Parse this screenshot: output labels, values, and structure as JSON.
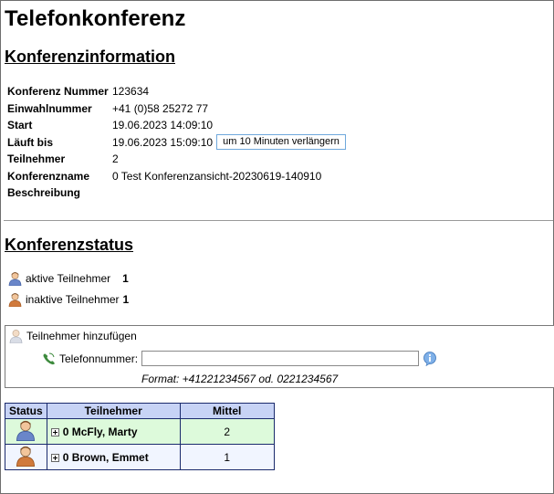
{
  "page": {
    "title": "Telefonkonferenz"
  },
  "conference_info": {
    "heading": "Konferenzinformation",
    "rows": [
      {
        "label": "Konferenz Nummer",
        "value": "123634"
      },
      {
        "label": "Einwahlnummer",
        "value": "+41 (0)58 25272 77"
      },
      {
        "label": "Start",
        "value": "19.06.2023 14:09:10"
      },
      {
        "label": "Läuft bis",
        "value": "19.06.2023 15:09:10"
      },
      {
        "label": "Teilnehmer",
        "value": "2"
      },
      {
        "label": "Konferenzname",
        "value": "0 Test Konferenzansicht-20230619-140910"
      },
      {
        "label": "Beschreibung",
        "value": ""
      }
    ],
    "extend_button_label": "um 10 Minuten verlängern"
  },
  "conference_status": {
    "heading": "Konferenzstatus",
    "active_label": "aktive Teilnehmer",
    "active_count": "1",
    "inactive_label": "inaktive Teilnehmer",
    "inactive_count": "1"
  },
  "add_participant": {
    "title": "Teilnehmer hinzufügen",
    "phone_label": "Telefonnummer:",
    "phone_value": "",
    "format_hint": "Format: +41221234567 od. 0221234567"
  },
  "participants_table": {
    "columns": [
      "Status",
      "Teilnehmer",
      "Mittel"
    ],
    "rows": [
      {
        "status": "active",
        "name": "0 McFly, Marty",
        "mittel": "2"
      },
      {
        "status": "inactive",
        "name": "0 Brown, Emmet",
        "mittel": "1"
      }
    ]
  },
  "colors": {
    "active_row": "#ddfadb",
    "inactive_row": "#f1f5ff",
    "table_header": "#c7d3f5",
    "active_person": "#6a86c9",
    "inactive_person": "#d07a3c"
  },
  "icons": {
    "active_person": "person-blue-icon",
    "inactive_person": "person-orange-icon",
    "add_person": "person-grey-icon",
    "phone": "phone-icon",
    "info": "info-icon",
    "expand": "expand-plus-icon"
  }
}
